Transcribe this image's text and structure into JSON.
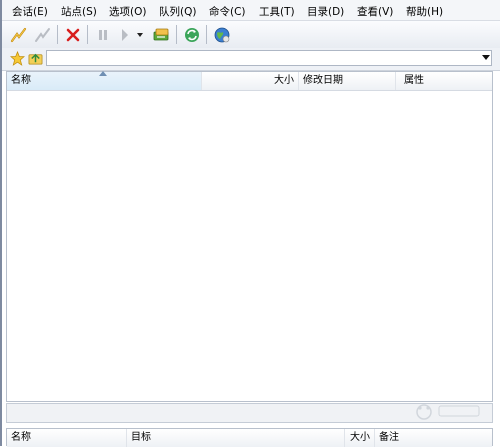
{
  "menu": {
    "items": [
      "会话(E)",
      "站点(S)",
      "选项(O)",
      "队列(Q)",
      "命令(C)",
      "工具(T)",
      "目录(D)",
      "查看(V)",
      "帮助(H)"
    ]
  },
  "toolbar": {
    "buttons": [
      "connect-icon",
      "disconnect-icon",
      "stop-icon",
      "pause-icon",
      "transfer-icon",
      "dropdown-icon",
      "transfer-queue-icon",
      "refresh-icon",
      "globe-icon"
    ]
  },
  "address": {
    "value": ""
  },
  "file_list": {
    "columns": [
      "名称",
      "大小",
      "修改日期",
      "属性"
    ],
    "rows": []
  },
  "queue": {
    "columns": [
      "名称",
      "目标",
      "大小",
      "备注"
    ]
  },
  "colors": {
    "menu_bg": "#f4f6f9",
    "toolbar_bg": "#e8ecf2",
    "sorted_column_bg": "#d9ebf8",
    "stop_red": "#d81e1e"
  }
}
